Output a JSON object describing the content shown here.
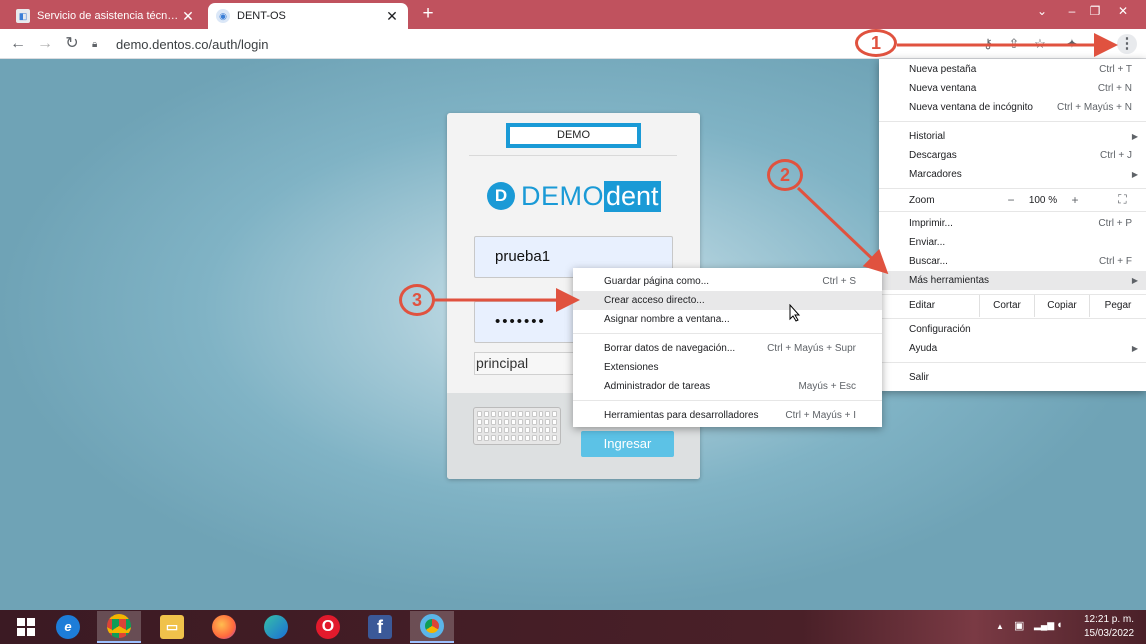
{
  "browser": {
    "tabs": [
      {
        "title": "Servicio de asistencia técnica : Sy",
        "icon": "help-desk-favicon"
      },
      {
        "title": "DENT-OS",
        "icon": "dentos-favicon"
      }
    ],
    "url": "demo.dentos.co/auth/login",
    "new_tab_label": "+",
    "close_glyph": "✕"
  },
  "login": {
    "badge": "DEMO",
    "brand_part1": "DEMO",
    "brand_part2": "dent",
    "username": "prueba1",
    "password_mask": "•••••••",
    "site": "principal",
    "submit_label": "Ingresar"
  },
  "chrome_menu": {
    "group1": [
      {
        "label": "Nueva pestaña",
        "shortcut": "Ctrl + T"
      },
      {
        "label": "Nueva ventana",
        "shortcut": "Ctrl + N"
      },
      {
        "label": "Nueva ventana de incógnito",
        "shortcut": "Ctrl + Mayús + N"
      }
    ],
    "group2": [
      {
        "label": "Historial",
        "shortcut": ""
      },
      {
        "label": "Descargas",
        "shortcut": "Ctrl + J"
      },
      {
        "label": "Marcadores",
        "shortcut": ""
      }
    ],
    "zoom": {
      "label": "Zoom",
      "minus": "−",
      "value": "100 %",
      "plus": "+"
    },
    "group3": [
      {
        "label": "Imprimir...",
        "shortcut": "Ctrl + P"
      },
      {
        "label": "Enviar...",
        "shortcut": ""
      },
      {
        "label": "Buscar...",
        "shortcut": "Ctrl + F"
      },
      {
        "label": "Más herramientas",
        "shortcut": ""
      }
    ],
    "edit": {
      "label": "Editar",
      "cut": "Cortar",
      "copy": "Copiar",
      "paste": "Pegar"
    },
    "group4": [
      {
        "label": "Configuración",
        "shortcut": ""
      },
      {
        "label": "Ayuda",
        "shortcut": ""
      }
    ],
    "exit": "Salir"
  },
  "submenu": {
    "group1": [
      {
        "label": "Guardar página como...",
        "shortcut": "Ctrl + S"
      },
      {
        "label": "Crear acceso directo...",
        "shortcut": ""
      },
      {
        "label": "Asignar nombre a ventana...",
        "shortcut": ""
      }
    ],
    "group2": [
      {
        "label": "Borrar datos de navegación...",
        "shortcut": "Ctrl + Mayús + Supr"
      },
      {
        "label": "Extensiones",
        "shortcut": ""
      },
      {
        "label": "Administrador de tareas",
        "shortcut": "Mayús + Esc"
      }
    ],
    "group3": [
      {
        "label": "Herramientas para desarrolladores",
        "shortcut": "Ctrl + Mayús + I"
      }
    ]
  },
  "annotations": {
    "step1": "1",
    "step2": "2",
    "step3": "3",
    "color": "#e0523f"
  },
  "taskbar": {
    "apps": [
      "start-icon",
      "edge-legacy-icon",
      "chrome-icon",
      "file-explorer-icon",
      "firefox-icon",
      "edge-icon",
      "opera-icon",
      "facebook-icon",
      "chrome-canary-icon"
    ],
    "time": "12:21 p. m.",
    "date": "15/03/2022"
  },
  "colors": {
    "tab_bar": "#c0525e",
    "brand_blue": "#1a9ad6",
    "page_bg": "#6fa3b6"
  }
}
